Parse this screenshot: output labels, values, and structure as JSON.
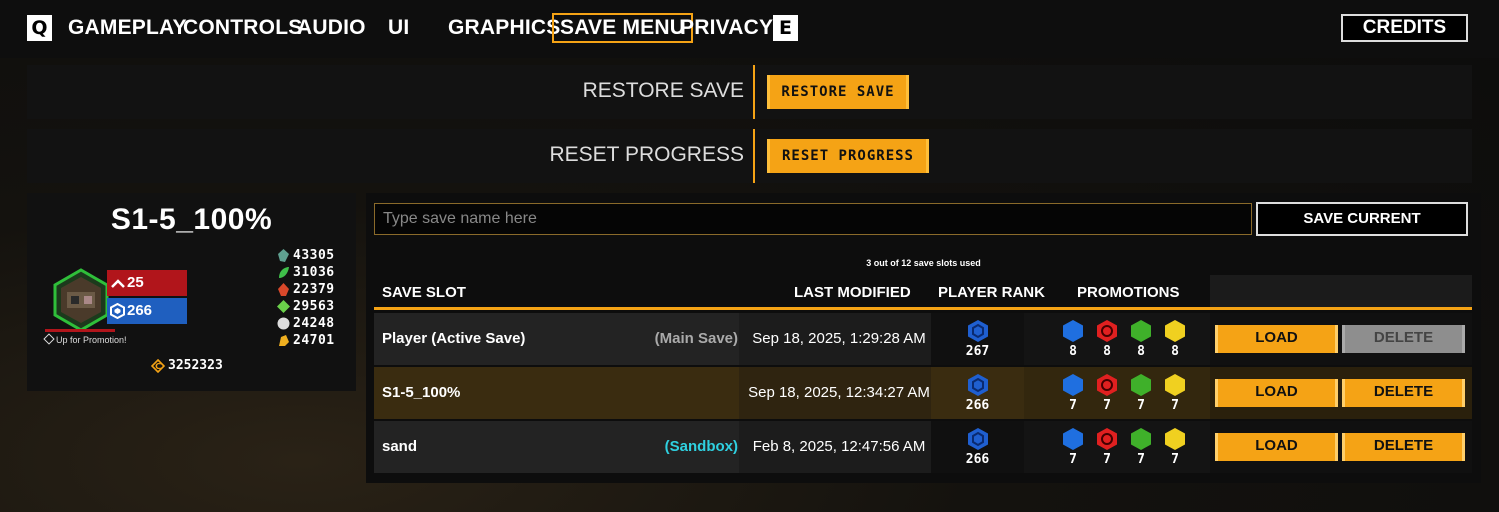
{
  "nav": {
    "prev_key": "Q",
    "next_key": "E",
    "tabs": [
      {
        "label": "GAMEPLAY"
      },
      {
        "label": "CONTROLS"
      },
      {
        "label": "AUDIO"
      },
      {
        "label": "UI"
      },
      {
        "label": "GRAPHICS"
      },
      {
        "label": "SAVE MENU",
        "active": true
      },
      {
        "label": "PRIVACY"
      }
    ],
    "credits_label": "CREDITS"
  },
  "restore": {
    "label": "RESTORE SAVE",
    "button": "RESTORE SAVE"
  },
  "reset": {
    "label": "RESET PROGRESS",
    "button": "RESET PROGRESS"
  },
  "profile": {
    "name": "S1-5_100%",
    "rank": "25",
    "level": "266",
    "promotion_text": "Up for Promotion!",
    "resources": [
      "43305",
      "31036",
      "22379",
      "29563",
      "24248",
      "24701"
    ],
    "credits": "3252323"
  },
  "save_panel": {
    "input_placeholder": "Type save name here",
    "save_current_label": "SAVE CURRENT",
    "slots_used": "3 out of 12 save slots used",
    "headers": {
      "slot": "SAVE SLOT",
      "modified": "LAST MODIFIED",
      "rank": "PLAYER RANK",
      "promotions": "PROMOTIONS"
    },
    "rows": [
      {
        "name": "Player (Active Save)",
        "tag": "(Main Save)",
        "date": "Sep 18, 2025, 1:29:28 AM",
        "rank": "267",
        "promos": [
          "8",
          "8",
          "8",
          "8"
        ],
        "load": "LOAD",
        "delete": "DELETE"
      },
      {
        "name": "S1-5_100%",
        "tag": "",
        "date": "Sep 18, 2025, 12:34:27 AM",
        "rank": "266",
        "promos": [
          "7",
          "7",
          "7",
          "7"
        ],
        "load": "LOAD",
        "delete": "DELETE"
      },
      {
        "name": "sand",
        "tag": "(Sandbox)",
        "date": "Feb 8, 2025, 12:47:56 AM",
        "rank": "266",
        "promos": [
          "7",
          "7",
          "7",
          "7"
        ],
        "load": "LOAD",
        "delete": "DELETE"
      }
    ]
  },
  "colors": {
    "accent": "#f5a315",
    "rank_red": "#b1151b",
    "level_blue": "#1f5fbf",
    "sandbox_cyan": "#2fd0e0",
    "main_save_gray": "#aaaaaa"
  }
}
